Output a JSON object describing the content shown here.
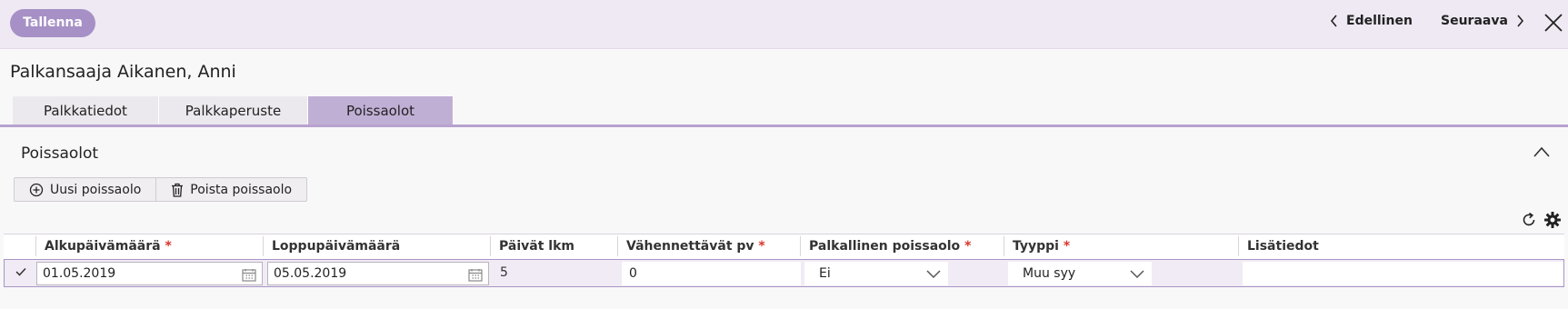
{
  "toolbar": {
    "save_label": "Tallenna",
    "prev_label": "Edellinen",
    "next_label": "Seuraava"
  },
  "page": {
    "title": "Palkansaaja Aikanen, Anni"
  },
  "tabs": [
    {
      "label": "Palkkatiedot",
      "active": false
    },
    {
      "label": "Palkkaperuste",
      "active": false
    },
    {
      "label": "Poissaolot",
      "active": true
    }
  ],
  "section": {
    "title": "Poissaolot",
    "new_label": "Uusi poissaolo",
    "delete_label": "Poista poissaolo"
  },
  "columns": [
    {
      "label": "Alkupäivämäärä",
      "required": "*"
    },
    {
      "label": "Loppupäivämäärä",
      "required": ""
    },
    {
      "label": "Päivät lkm",
      "required": ""
    },
    {
      "label": "Vähennettävät pv",
      "required": "*"
    },
    {
      "label": "Palkallinen poissaolo",
      "required": "*"
    },
    {
      "label": "Tyyppi",
      "required": "*"
    },
    {
      "label": "Lisätiedot",
      "required": ""
    }
  ],
  "row": {
    "start_date": "01.05.2019",
    "end_date": "05.05.2019",
    "days": "5",
    "deductible_days": "0",
    "paid_absence": "Ei",
    "type": "Muu syy",
    "notes": ""
  },
  "colors": {
    "accent": "#a690c6",
    "tab_active": "#c0afd5",
    "required": "#d9342b"
  }
}
